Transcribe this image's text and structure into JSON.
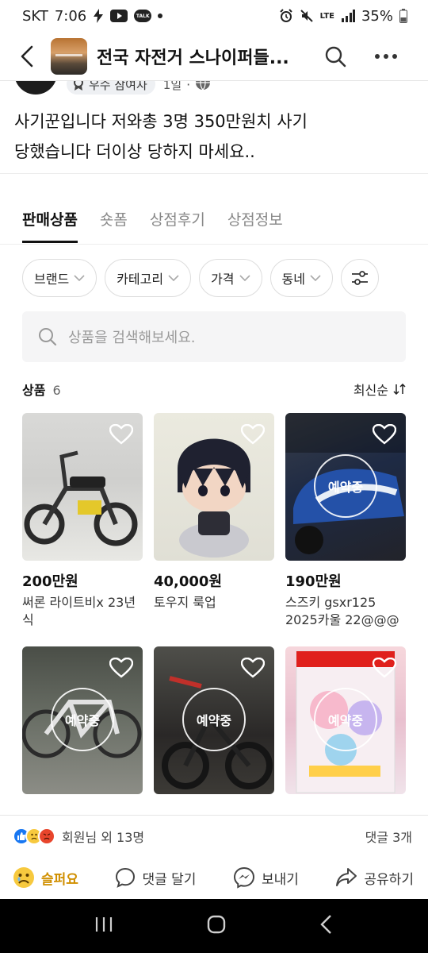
{
  "status": {
    "carrier": "SKT",
    "time": "7:06",
    "talk_badge": "TALK",
    "network": "LTE",
    "battery": "35%"
  },
  "header": {
    "group_name": "전국 자전거 스나이퍼들..."
  },
  "author": {
    "badge": "우수 참여자",
    "time": "1일"
  },
  "post": {
    "line1": "사기꾼입니다 저와총 3명 350만원치 사기",
    "line2": "당했습니다 더이상 당하지 마세요.."
  },
  "shop": {
    "tabs": [
      {
        "label": "판매상품",
        "active": true
      },
      {
        "label": "숏폼",
        "active": false
      },
      {
        "label": "상점후기",
        "active": false
      },
      {
        "label": "상점정보",
        "active": false
      }
    ],
    "filters": [
      "브랜드",
      "카테고리",
      "가격",
      "동네"
    ],
    "search_placeholder": "상품을 검색해보세요.",
    "count_label": "상품",
    "count": "6",
    "sort": "최신순",
    "reserved_label": "예약중",
    "products": [
      {
        "price": "200만원",
        "title": "써론 라이트비x 23년식",
        "reserved": false,
        "icon": "motorbike"
      },
      {
        "price": "40,000원",
        "title": "토우지 룩업",
        "reserved": false,
        "icon": "figure"
      },
      {
        "price": "190만원",
        "title": "스즈키 gsxr125 2025카울 22@@@",
        "reserved": true,
        "icon": "motorbike"
      },
      {
        "price": "",
        "title": "",
        "reserved": true,
        "icon": "bicycle"
      },
      {
        "price": "",
        "title": "",
        "reserved": true,
        "icon": "motorbike"
      },
      {
        "price": "",
        "title": "",
        "reserved": true,
        "icon": "game-case"
      }
    ]
  },
  "reactions": {
    "label": "회원님 외 13명",
    "comments": "댓글 3개"
  },
  "actions": {
    "sad": "슬퍼요",
    "comment": "댓글 달기",
    "send": "보내기",
    "share": "공유하기"
  },
  "colors": {
    "sad_accent": "#d08f00",
    "like_blue": "#1877f2",
    "angry_red": "#e8452c"
  }
}
